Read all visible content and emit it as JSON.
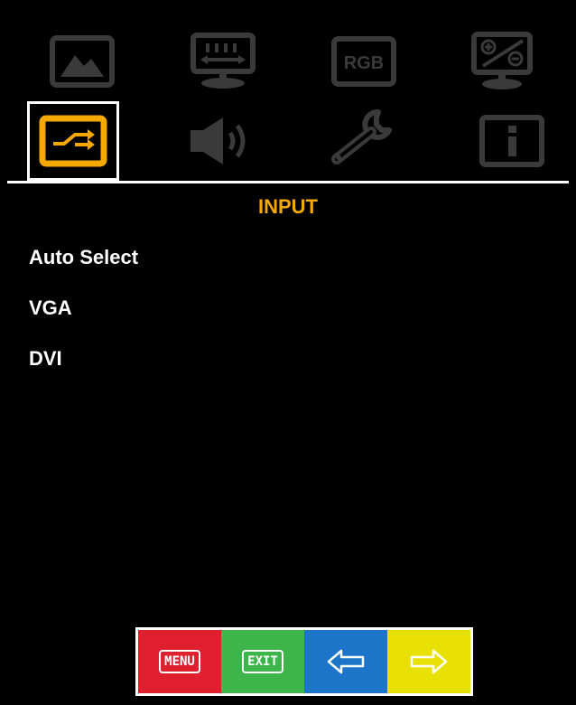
{
  "colors": {
    "background": "#000000",
    "icon_inactive": "#3a3a3a",
    "icon_selected": "#f5a800",
    "title": "#f5a800",
    "text": "#ffffff",
    "key_menu": "#e0202e",
    "key_exit": "#3db54a",
    "key_left": "#1c75c9",
    "key_right": "#e8e000"
  },
  "tabs": [
    {
      "icon": "picture-icon"
    },
    {
      "icon": "display-position-icon"
    },
    {
      "icon": "rgb-icon",
      "label": "RGB"
    },
    {
      "icon": "zoom-icon"
    },
    {
      "icon": "input-icon",
      "selected": true
    },
    {
      "icon": "speaker-icon"
    },
    {
      "icon": "wrench-icon"
    },
    {
      "icon": "info-icon"
    }
  ],
  "menu": {
    "title": "INPUT",
    "items": [
      {
        "label": "Auto Select"
      },
      {
        "label": "VGA"
      },
      {
        "label": "DVI"
      }
    ]
  },
  "keys": {
    "menu_label": "MENU",
    "exit_label": "EXIT",
    "left_icon": "arrow-left-icon",
    "right_icon": "arrow-right-icon"
  }
}
